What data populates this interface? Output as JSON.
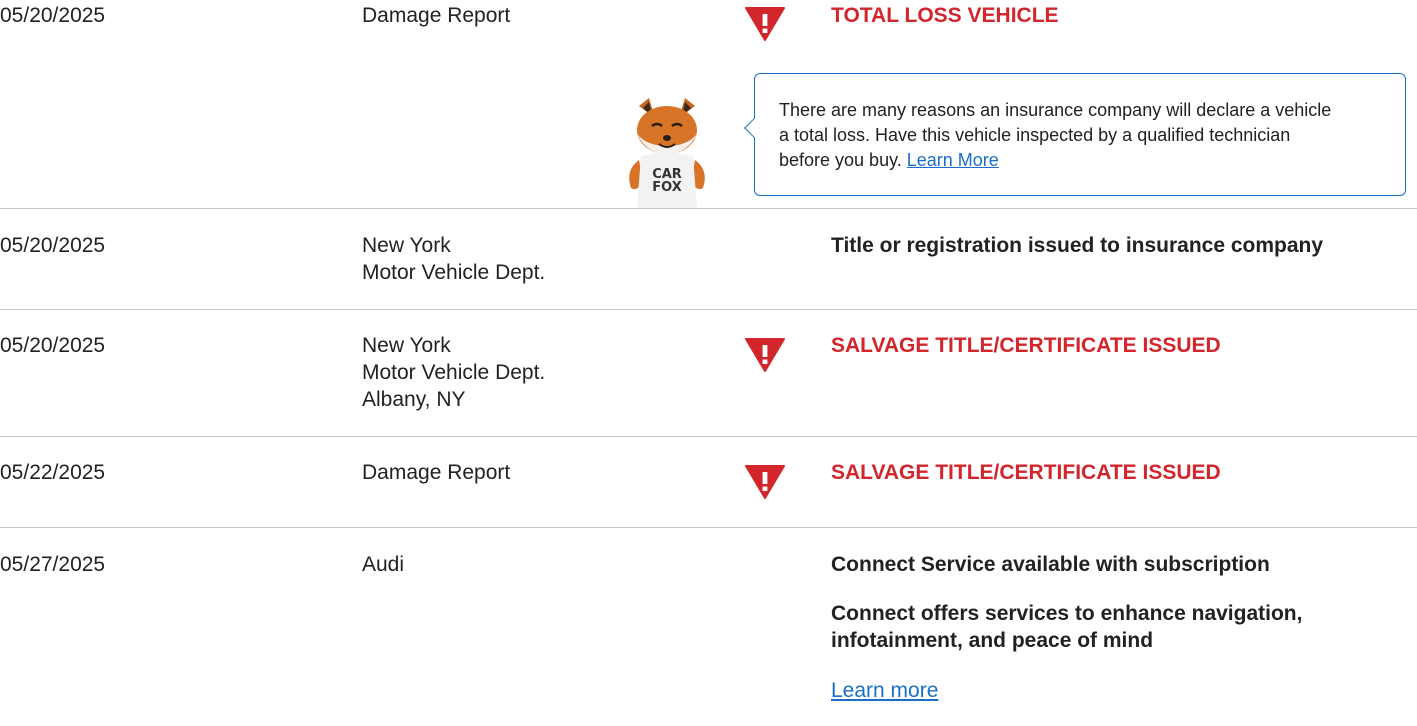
{
  "rows": [
    {
      "date": "05/20/2025",
      "source": [
        "Damage Report"
      ],
      "alert": true,
      "comment": "TOTAL LOSS VEHICLE"
    },
    {
      "date": "05/20/2025",
      "source": [
        "New York",
        "Motor Vehicle Dept."
      ],
      "alert": false,
      "comment": "Title or registration issued to insurance company"
    },
    {
      "date": "05/20/2025",
      "source": [
        "New York",
        "Motor Vehicle Dept.",
        "Albany, NY"
      ],
      "alert": true,
      "comment": "SALVAGE TITLE/CERTIFICATE ISSUED"
    },
    {
      "date": "05/22/2025",
      "source": [
        "Damage Report"
      ],
      "alert": true,
      "comment": "SALVAGE TITLE/CERTIFICATE ISSUED"
    },
    {
      "date": "05/27/2025",
      "source": [
        "Audi"
      ],
      "alert": false,
      "comment": "Connect Service available with subscription",
      "comment_extra": [
        "Connect offers services to enhance navigation,",
        "infotainment, and peace of mind"
      ],
      "comment_link": "Learn more"
    }
  ],
  "tooltip": {
    "text_line1": "There are many reasons an insurance company will declare a vehicle",
    "text_line2": "a total loss. Have this vehicle inspected by a qualified technician",
    "text_line3": "before you buy.",
    "link": "Learn More"
  },
  "mascot": {
    "shirt_line1": "CAR",
    "shirt_line2": "FOX"
  },
  "colors": {
    "alert_red": "#d3262c",
    "link_blue": "#1a6fc9",
    "divider": "#c8c8c8"
  },
  "icons": {
    "alert": "alert-triangle-icon"
  }
}
